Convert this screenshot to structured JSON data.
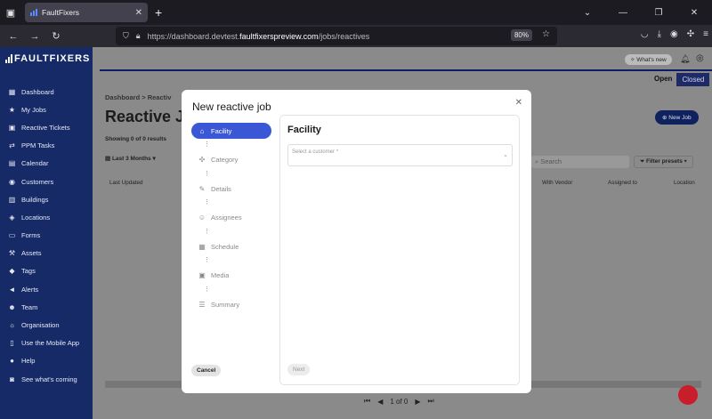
{
  "browser": {
    "tab_title": "FaultFixers",
    "url_prefix": "https://dashboard.devtest.",
    "url_host": "faultfixerspreview.com",
    "url_path": "/jobs/reactives",
    "zoom": "80%"
  },
  "sidebar": {
    "logo": "FAULTFIXERS",
    "items": [
      {
        "label": "Dashboard",
        "icon": "dashboard-icon",
        "glyph": "▦"
      },
      {
        "label": "My Jobs",
        "icon": "star-icon",
        "glyph": "★"
      },
      {
        "label": "Reactive Tickets",
        "icon": "chat-icon",
        "glyph": "▣"
      },
      {
        "label": "PPM Tasks",
        "icon": "repeat-icon",
        "glyph": "⇄"
      },
      {
        "label": "Calendar",
        "icon": "calendar-icon",
        "glyph": "▤"
      },
      {
        "label": "Customers",
        "icon": "customers-icon",
        "glyph": "◉"
      },
      {
        "label": "Buildings",
        "icon": "building-icon",
        "glyph": "▥"
      },
      {
        "label": "Locations",
        "icon": "location-icon",
        "glyph": "◈"
      },
      {
        "label": "Forms",
        "icon": "forms-icon",
        "glyph": "▭"
      },
      {
        "label": "Assets",
        "icon": "wrench-icon",
        "glyph": "⚒"
      },
      {
        "label": "Tags",
        "icon": "tag-icon",
        "glyph": "◆"
      },
      {
        "label": "Alerts",
        "icon": "alerts-icon",
        "glyph": "◄"
      },
      {
        "label": "Team",
        "icon": "team-icon",
        "glyph": "☻"
      },
      {
        "label": "Organisation",
        "icon": "organisation-icon",
        "glyph": "☼"
      },
      {
        "label": "Use the Mobile App",
        "icon": "mobile-icon",
        "glyph": "▯"
      },
      {
        "label": "Help",
        "icon": "help-icon",
        "glyph": "●"
      },
      {
        "label": "See what's coming",
        "icon": "comment-icon",
        "glyph": "◙"
      }
    ]
  },
  "app": {
    "whats_new": "What's new",
    "open_label": "Open",
    "closed_label": "Closed",
    "breadcrumb": "Dashboard   >   Reactiv",
    "page_title": "Reactive Jo",
    "showing": "Showing 0 of 0 results",
    "new_job": "New Job",
    "date_filter": "Last 3 Months",
    "search_placeholder": "Search",
    "filter_presets": "Filter presets",
    "columns": [
      "Last Updated",
      "With Vendor",
      "Assigned to",
      "Location"
    ],
    "pagination": "1 of 0"
  },
  "modal": {
    "title": "New reactive job",
    "steps": [
      {
        "label": "Facility",
        "icon": "home-icon",
        "glyph": "⌂"
      },
      {
        "label": "Category",
        "icon": "puzzle-icon",
        "glyph": "✣"
      },
      {
        "label": "Details",
        "icon": "pencil-icon",
        "glyph": "✎"
      },
      {
        "label": "Assignees",
        "icon": "add-user-icon",
        "glyph": "☺"
      },
      {
        "label": "Schedule",
        "icon": "calendar-icon",
        "glyph": "▦"
      },
      {
        "label": "Media",
        "icon": "image-icon",
        "glyph": "▣"
      },
      {
        "label": "Summary",
        "icon": "list-icon",
        "glyph": "☰"
      }
    ],
    "cancel": "Cancel",
    "panel_title": "Facility",
    "customer_placeholder": "Select a customer *",
    "next": "Next"
  },
  "colors": {
    "sidebar": "#162a68",
    "accent": "#3a58d6",
    "closed_tab": "#1d2a66"
  }
}
